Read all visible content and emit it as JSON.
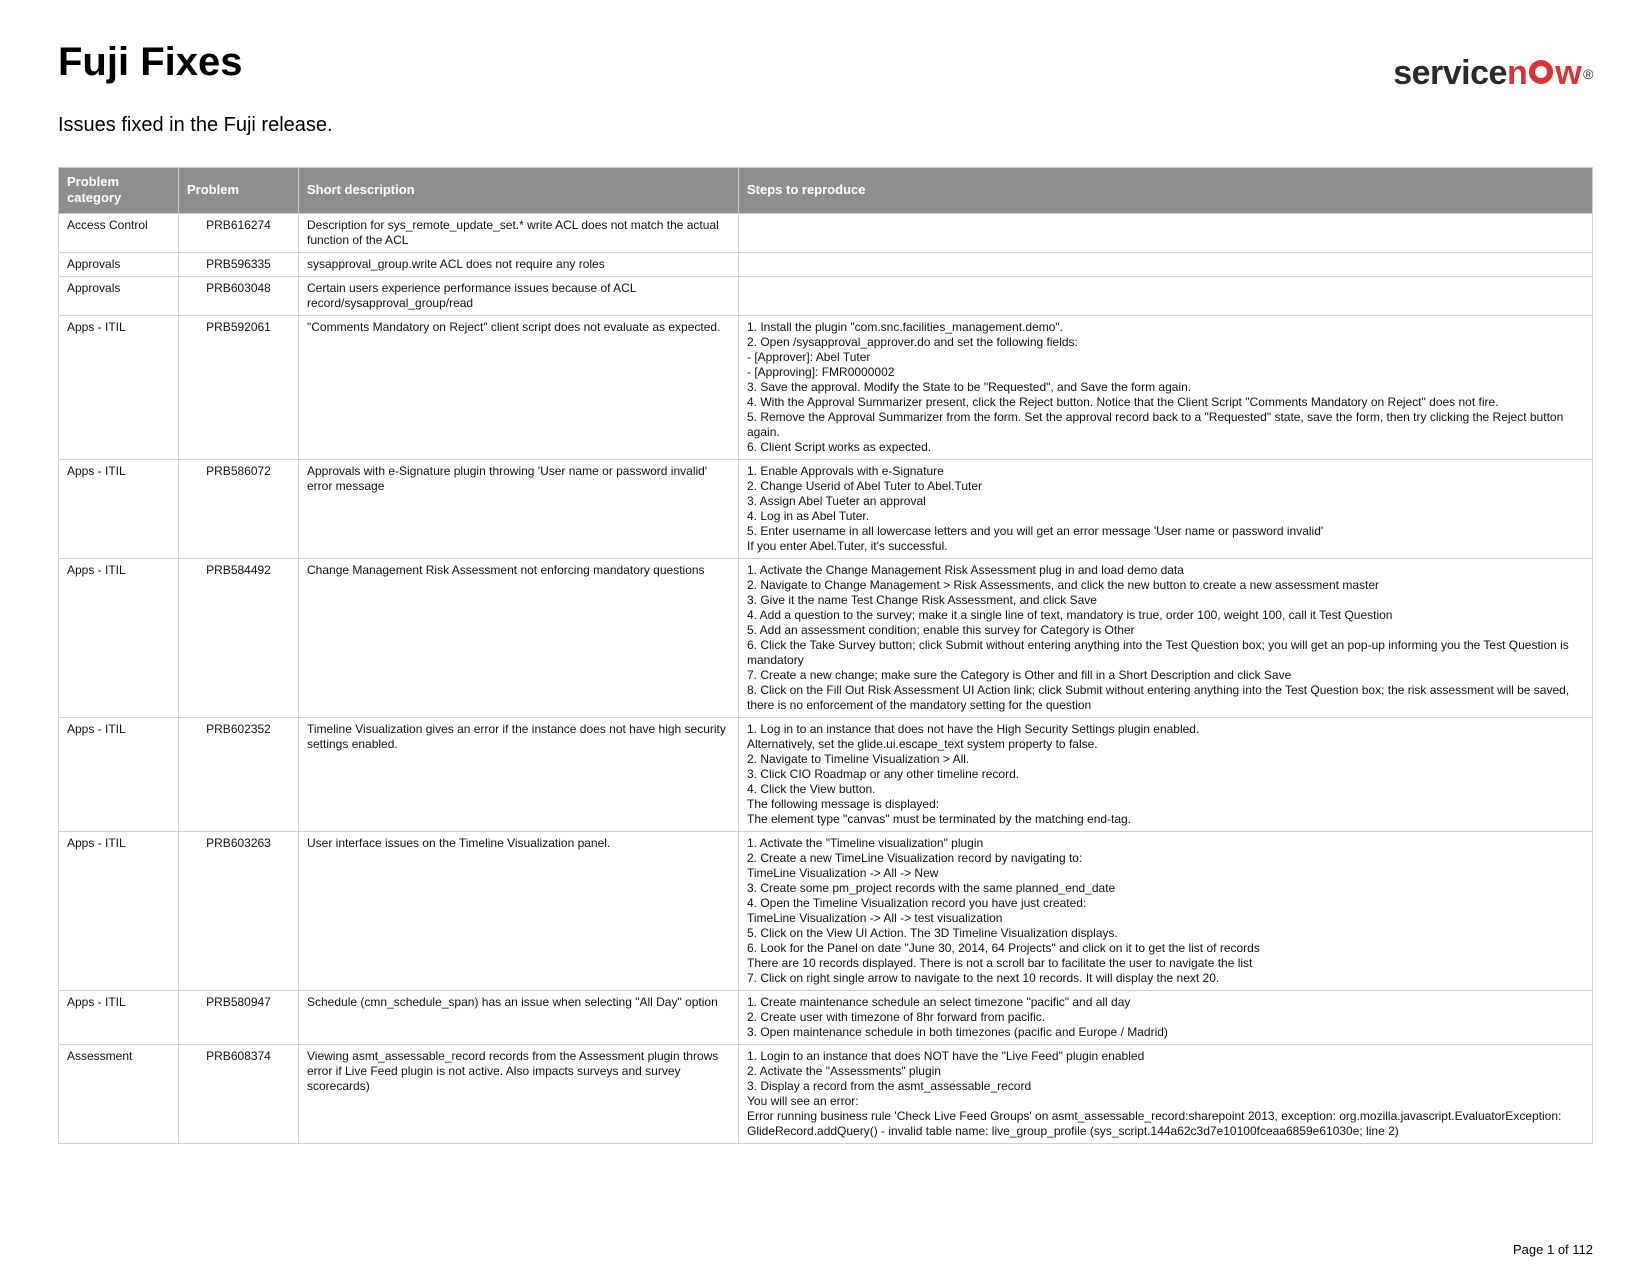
{
  "title": "Fuji Fixes",
  "subtitle": "Issues fixed in the Fuji release.",
  "logo": {
    "prefix": "service",
    "suffix": "w"
  },
  "columns": {
    "cat": "Problem category",
    "prob": "Problem",
    "desc": "Short description",
    "steps": "Steps to reproduce"
  },
  "rows": [
    {
      "cat": "Access Control",
      "prob": "PRB616274",
      "desc": "Description for sys_remote_update_set.* write ACL does not match the actual function of the ACL",
      "steps": ""
    },
    {
      "cat": "Approvals",
      "prob": "PRB596335",
      "desc": "sysapproval_group.write ACL does not require any roles",
      "steps": ""
    },
    {
      "cat": "Approvals",
      "prob": "PRB603048",
      "desc": "Certain users experience performance issues because of ACL record/sysapproval_group/read",
      "steps": ""
    },
    {
      "cat": "Apps - ITIL",
      "prob": "PRB592061",
      "desc": "\"Comments Mandatory on Reject\" client script does not evaluate as expected.",
      "steps": "1. Install the plugin \"com.snc.facilities_management.demo\".\n2. Open /sysapproval_approver.do and set the following fields:\n - [Approver]: Abel Tuter\n - [Approving]: FMR0000002\n3. Save the approval. Modify the State to be \"Requested\", and Save the form again.\n4. With the Approval Summarizer present, click the Reject button. Notice that the Client Script \"Comments Mandatory on Reject\" does not fire.\n5. Remove the Approval Summarizer from the form. Set the approval record back to a \"Requested\" state, save the form, then try clicking the Reject button again.\n6. Client Script works as expected."
    },
    {
      "cat": "Apps - ITIL",
      "prob": "PRB586072",
      "desc": "Approvals with e-Signature plugin throwing 'User name or password invalid' error message",
      "steps": "1. Enable Approvals with e-Signature\n2. Change Userid of Abel Tuter to Abel.Tuter\n3. Assign Abel Tueter an approval\n4. Log in as Abel Tuter.\n5. Enter username in all lowercase letters and you will get an error message 'User name or password invalid'\nIf you enter Abel.Tuter, it's successful."
    },
    {
      "cat": "Apps - ITIL",
      "prob": "PRB584492",
      "desc": "Change Management Risk Assessment not enforcing mandatory questions",
      "steps": "1.  Activate the Change Management Risk Assessment plug in and load demo data\n2.  Navigate to Change Management > Risk Assessments, and click the new button to create a new assessment master\n3.  Give it the name Test Change Risk Assessment, and click Save\n4.  Add a question to the survey; make it a single line of text, mandatory is true, order 100, weight 100, call it Test Question\n5.  Add an assessment condition; enable this survey for Category is Other\n6.  Click the Take Survey button; click Submit without entering anything into the Test Question box; you will get an pop-up informing you the Test Question is mandatory\n7.  Create a new change; make sure the Category is Other and fill in a Short Description and click Save\n8.  Click on the Fill Out Risk Assessment UI Action link; click Submit without entering anything into the Test Question box; the risk assessment will be saved, there is no enforcement of the mandatory setting for the question"
    },
    {
      "cat": "Apps - ITIL",
      "prob": "PRB602352",
      "desc": "Timeline Visualization gives an error if the instance does not have high security settings enabled.",
      "steps": "1. Log in to an instance that does not have the High Security Settings plugin enabled.\nAlternatively, set the glide.ui.escape_text system property to false.\n2. Navigate to Timeline Visualization > All.\n3. Click CIO Roadmap or any other timeline record.\n4. Click the View button.\nThe following message is displayed:\nThe element type \"canvas\" must be terminated by the matching end-tag."
    },
    {
      "cat": "Apps - ITIL",
      "prob": "PRB603263",
      "desc": "User interface issues on the Timeline Visualization panel.",
      "steps": "1. Activate the \"Timeline visualization\" plugin\n2. Create a new TimeLine Visualization record by navigating to:\nTimeLine Visualization -> All -> New\n3. Create some pm_project records with the same planned_end_date\n4. Open the Timeline Visualization record you have just created:\nTimeLine Visualization -> All -> test visualization\n5.  Click on the View UI Action. The 3D Timeline Visualization displays.\n6. Look for the Panel on date \"June 30, 2014, 64 Projects\" and click on it to get the list of records\nThere are 10 records displayed. There is not a scroll bar to facilitate the user to navigate the list\n7. Click on right single arrow to navigate to the next 10 records. It will display the next 20."
    },
    {
      "cat": "Apps - ITIL",
      "prob": "PRB580947",
      "desc": "Schedule (cmn_schedule_span) has an issue when selecting \"All Day\" option",
      "steps": "1. Create maintenance schedule an select timezone \"pacific\" and all day\n2. Create user with timezone of 8hr forward from pacific.\n3. Open maintenance schedule in both timezones (pacific and Europe / Madrid)"
    },
    {
      "cat": "Assessment",
      "prob": "PRB608374",
      "desc": "Viewing asmt_assessable_record records from the Assessment plugin throws error if Live Feed plugin is not active. Also impacts surveys and survey scorecards)",
      "steps": "1. Login to an instance that does NOT have the \"Live Feed\" plugin enabled\n2. Activate the \"Assessments\" plugin\n3. Display a record from the asmt_assessable_record\nYou will see an error:\nError running business rule 'Check Live Feed Groups' on asmt_assessable_record:sharepoint 2013, exception: org.mozilla.javascript.EvaluatorException: GlideRecord.addQuery() - invalid table name: live_group_profile (sys_script.144a62c3d7e10100fceaa6859e61030e; line 2)"
    }
  ],
  "footer": "Page 1 of 112"
}
